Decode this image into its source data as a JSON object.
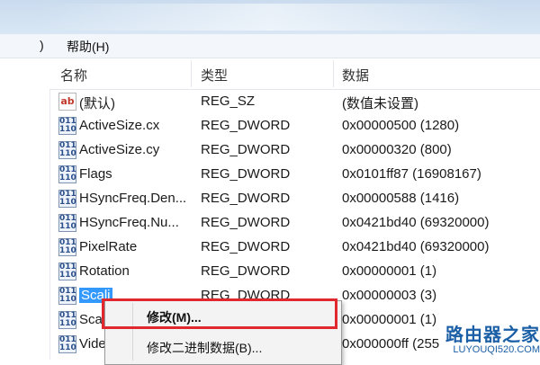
{
  "menu": {
    "left_fragment": ")",
    "help": "帮助(H)"
  },
  "columns": {
    "name": "名称",
    "type": "类型",
    "data": "数据"
  },
  "rows": [
    {
      "icon": "ab",
      "name": "(默认)",
      "type": "REG_SZ",
      "data": "(数值未设置)"
    },
    {
      "icon": "dw",
      "name": "ActiveSize.cx",
      "type": "REG_DWORD",
      "data": "0x00000500 (1280)"
    },
    {
      "icon": "dw",
      "name": "ActiveSize.cy",
      "type": "REG_DWORD",
      "data": "0x00000320 (800)"
    },
    {
      "icon": "dw",
      "name": "Flags",
      "type": "REG_DWORD",
      "data": "0x0101ff87 (16908167)"
    },
    {
      "icon": "dw",
      "name": "HSyncFreq.Den...",
      "type": "REG_DWORD",
      "data": "0x00000588 (1416)"
    },
    {
      "icon": "dw",
      "name": "HSyncFreq.Nu...",
      "type": "REG_DWORD",
      "data": "0x0421bd40 (69320000)"
    },
    {
      "icon": "dw",
      "name": "PixelRate",
      "type": "REG_DWORD",
      "data": "0x0421bd40 (69320000)"
    },
    {
      "icon": "dw",
      "name": "Rotation",
      "type": "REG_DWORD",
      "data": "0x00000001 (1)"
    },
    {
      "icon": "dw",
      "name": "Scali",
      "type": "REG_DWORD",
      "data": "0x00000003 (3)",
      "selected": true
    },
    {
      "icon": "dw",
      "name": "Sca",
      "type": "",
      "data": "0x00000001 (1)"
    },
    {
      "icon": "dw",
      "name": "Vide",
      "type": "",
      "data": "0x000000ff (255"
    }
  ],
  "context_menu": {
    "modify": "修改(M)...",
    "modify_binary": "修改二进制数据(B)..."
  },
  "watermark": {
    "title": "路由器之家",
    "url": "LUYOUQI520.COM"
  },
  "icon_text": {
    "ab": "ab",
    "dw": "011 110"
  }
}
